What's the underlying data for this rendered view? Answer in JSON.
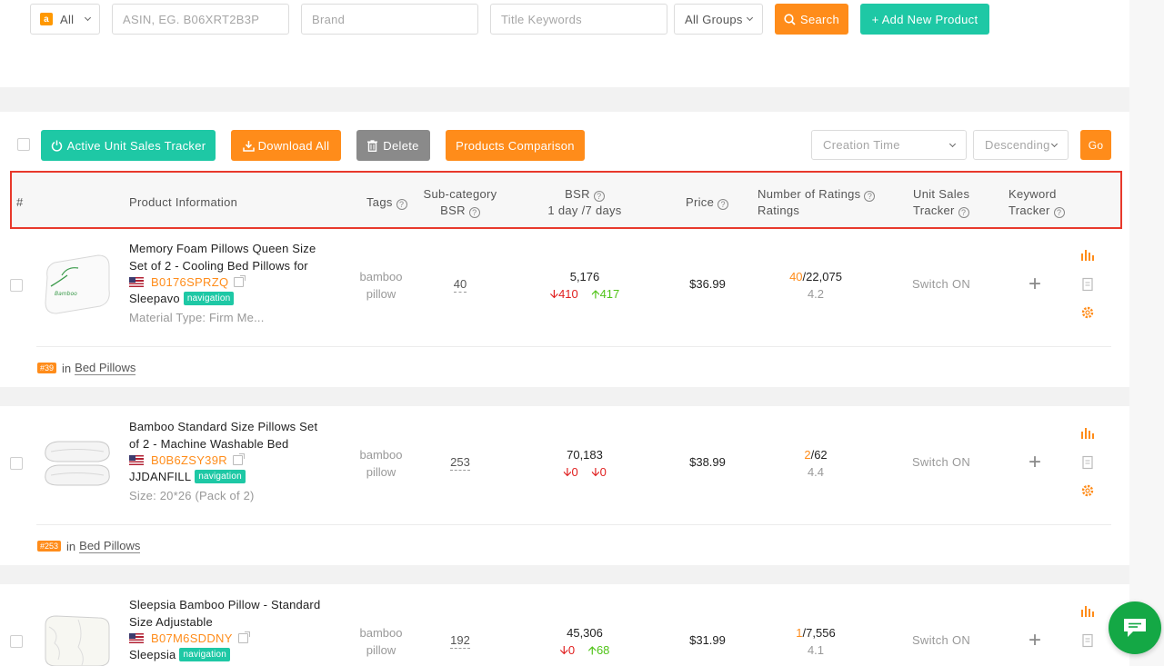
{
  "search": {
    "marketplace": "All",
    "asin_placeholder": "ASIN, EG. B06XRT2B3P",
    "brand_placeholder": "Brand",
    "keywords_placeholder": "Title Keywords",
    "groups": "All Groups",
    "search_label": "Search",
    "add_label": "+ Add New Product"
  },
  "toolbar": {
    "tracker_label": "Active Unit Sales Tracker",
    "download_label": "Download All",
    "delete_label": "Delete",
    "compare_label": "Products Comparison",
    "sort_field": "Creation Time",
    "sort_order": "Descending",
    "go_label": "Go"
  },
  "columns": {
    "index": "#",
    "product": "Product Information",
    "tags": "Tags",
    "subcat_1": "Sub-category",
    "subcat_2": "BSR",
    "bsr_1": "BSR",
    "bsr_2": "1 day /7 days",
    "price": "Price",
    "ratings_1": "Number of Ratings",
    "ratings_2": "Ratings",
    "unit_1": "Unit Sales",
    "unit_2": "Tracker",
    "kw_1": "Keyword",
    "kw_2": "Tracker"
  },
  "products": [
    {
      "title": "Memory Foam Pillows Queen Size Set of 2 - Cooling Bed Pillows for",
      "asin": "B0176SPRZQ",
      "brand": "Sleepavo",
      "badge": "navigation",
      "attr": "Material Type: Firm Me...",
      "tag_1": "bamboo",
      "tag_2": "pillow",
      "sub_bsr": "40",
      "bsr": "5,176",
      "bsr_day": "410",
      "bsr_week": "417",
      "price": "$36.99",
      "ratings_new": "40",
      "ratings_total": "/22,075",
      "rating": "4.2",
      "switch": "Switch ON",
      "rank": "#39",
      "in": "in",
      "category": "Bed Pillows"
    },
    {
      "title": "Bamboo Standard Size Pillows Set of 2 - Machine Washable Bed",
      "asin": "B0B6ZSY39R",
      "brand": "JJDANFILL",
      "badge": "navigation",
      "attr": "Size: 20*26 (Pack of 2)",
      "tag_1": "bamboo",
      "tag_2": "pillow",
      "sub_bsr": "253",
      "bsr": "70,183",
      "bsr_day": "0",
      "bsr_week": "0",
      "price": "$38.99",
      "ratings_new": "2",
      "ratings_total": "/62",
      "rating": "4.4",
      "switch": "Switch ON",
      "rank": "#253",
      "in": "in",
      "category": "Bed Pillows"
    },
    {
      "title": "Sleepsia Bamboo Pillow - Standard Size Adjustable",
      "asin": "B07M6SDDNY",
      "brand": "Sleepsia",
      "badge": "navigation",
      "tag_1": "bamboo",
      "tag_2": "pillow",
      "sub_bsr": "192",
      "bsr": "45,306",
      "bsr_day": "0",
      "bsr_week": "68",
      "price": "$31.99",
      "ratings_new": "1",
      "ratings_total": "/7,556",
      "rating": "4.1",
      "switch": "Switch ON"
    }
  ],
  "icons": {
    "chart": "bar-chart-icon",
    "note": "note-icon",
    "settings": "gear-icon",
    "chat": "chat-icon"
  },
  "colors": {
    "orange": "#ff8c1a",
    "teal": "#1ec8a5",
    "highlight": "#e8392c",
    "down": "#e02020",
    "up": "#52c41a",
    "chat": "#14a845"
  }
}
